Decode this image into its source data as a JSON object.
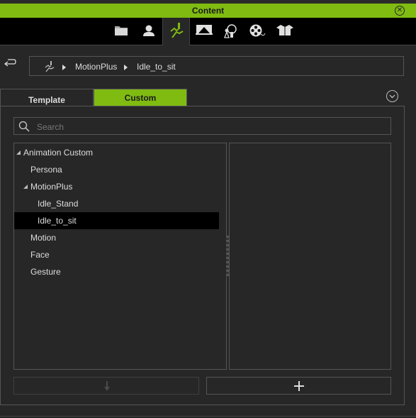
{
  "window": {
    "title": "Content",
    "accent": "#7fbb11"
  },
  "categories": [
    {
      "icon": "folder-icon",
      "active": false
    },
    {
      "icon": "avatar-icon",
      "active": false
    },
    {
      "icon": "motion-icon",
      "active": true
    },
    {
      "icon": "stage-icon",
      "active": false
    },
    {
      "icon": "scene-props-icon",
      "active": false
    },
    {
      "icon": "film-reel-icon",
      "active": false
    },
    {
      "icon": "package-box-icon",
      "active": false
    }
  ],
  "breadcrumb": {
    "items": [
      "MotionPlus",
      "Idle_to_sit"
    ]
  },
  "tabs": {
    "template": "Template",
    "custom": "Custom",
    "active": "Custom"
  },
  "search": {
    "placeholder": "Search",
    "value": ""
  },
  "tree": {
    "nodes": [
      {
        "label": "Animation Custom",
        "level": 0,
        "expanded": true
      },
      {
        "label": "Persona",
        "level": 1
      },
      {
        "label": "MotionPlus",
        "level": 1,
        "expanded": true
      },
      {
        "label": "Idle_Stand",
        "level": 2
      },
      {
        "label": "Idle_to_sit",
        "level": 2,
        "selected": true
      },
      {
        "label": "Motion",
        "level": 1
      },
      {
        "label": "Face",
        "level": 1
      },
      {
        "label": "Gesture",
        "level": 1
      }
    ]
  },
  "buttons": {
    "apply": "down-arrow-icon",
    "add": "plus-icon"
  }
}
